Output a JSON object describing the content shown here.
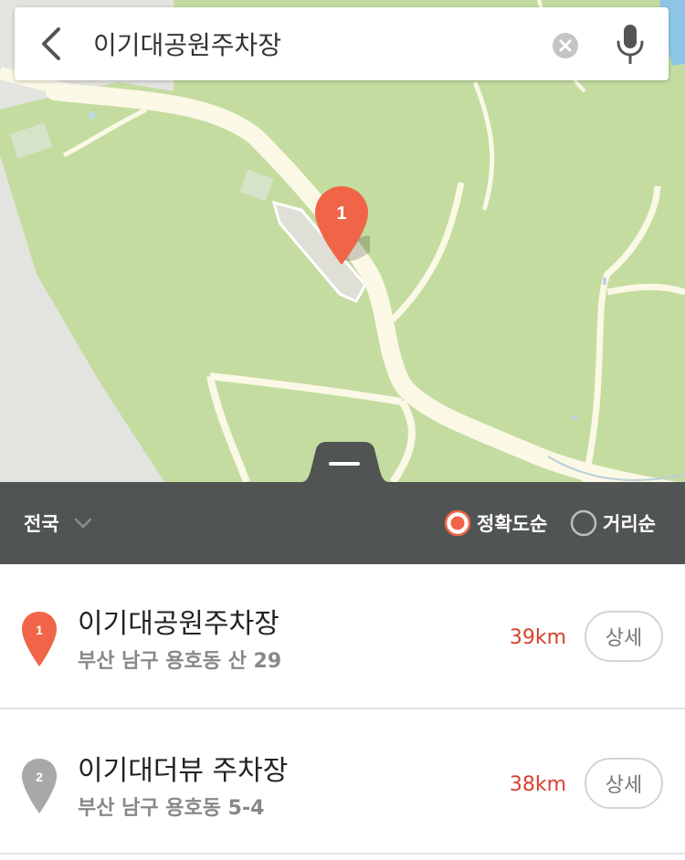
{
  "search": {
    "query": "이기대공원주차장"
  },
  "map": {
    "selected_marker_label": "1"
  },
  "filter": {
    "region_label": "전국",
    "sort_options": [
      {
        "label": "정확도순",
        "selected": true
      },
      {
        "label": "거리순",
        "selected": false
      }
    ]
  },
  "results": [
    {
      "index": "1",
      "name": "이기대공원주차장",
      "address": "부산 남구 용호동 산 29",
      "distance": "39km",
      "detail_label": "상세",
      "pin_color": "#f06548"
    },
    {
      "index": "2",
      "name": "이기대더뷰 주차장",
      "address": "부산 남구 용호동 5-4",
      "distance": "38km",
      "detail_label": "상세",
      "pin_color": "#a8a8a8"
    }
  ],
  "colors": {
    "accent": "#f06548",
    "distance": "#d9402d",
    "map_park": "#c4dca0",
    "map_road": "#fbf8e6",
    "filter_bar": "#505453"
  }
}
